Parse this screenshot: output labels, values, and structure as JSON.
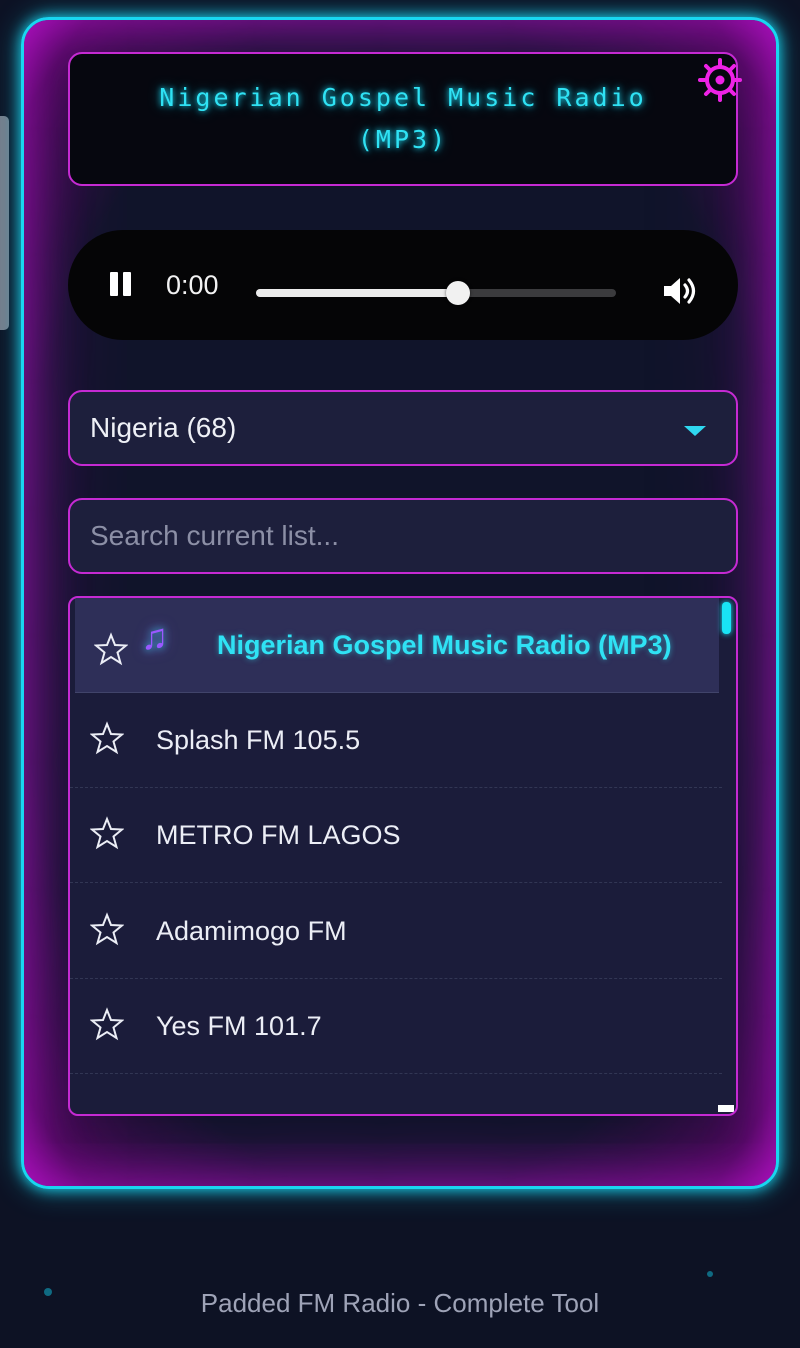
{
  "app": {
    "title": "Nigerian Gospel Music Radio (MP3)",
    "footer": "Padded FM Radio - Complete Tool",
    "accent_color": "#19d6f0",
    "border_color": "#c52ad3"
  },
  "player": {
    "time": "0:00",
    "state": "playing",
    "seek_progress": 0.56,
    "play_pause_icon": "pause-icon",
    "volume_icon": "volume-icon"
  },
  "country_select": {
    "selected": "Nigeria (68)"
  },
  "search": {
    "placeholder": "Search current list...",
    "value": ""
  },
  "stations": [
    {
      "name": "Nigerian Gospel Music Radio (MP3)",
      "active": true,
      "favorite": false
    },
    {
      "name": "Splash FM 105.5",
      "active": false,
      "favorite": false
    },
    {
      "name": "METRO FM LAGOS",
      "active": false,
      "favorite": false
    },
    {
      "name": "Adamimogo FM",
      "active": false,
      "favorite": false
    },
    {
      "name": "Yes FM 101.7",
      "active": false,
      "favorite": false
    }
  ],
  "icons": {
    "settings": "gear-icon",
    "favorite": "star-outline-icon",
    "now_playing": "music-note-icon",
    "dropdown": "chevron-down-icon"
  }
}
